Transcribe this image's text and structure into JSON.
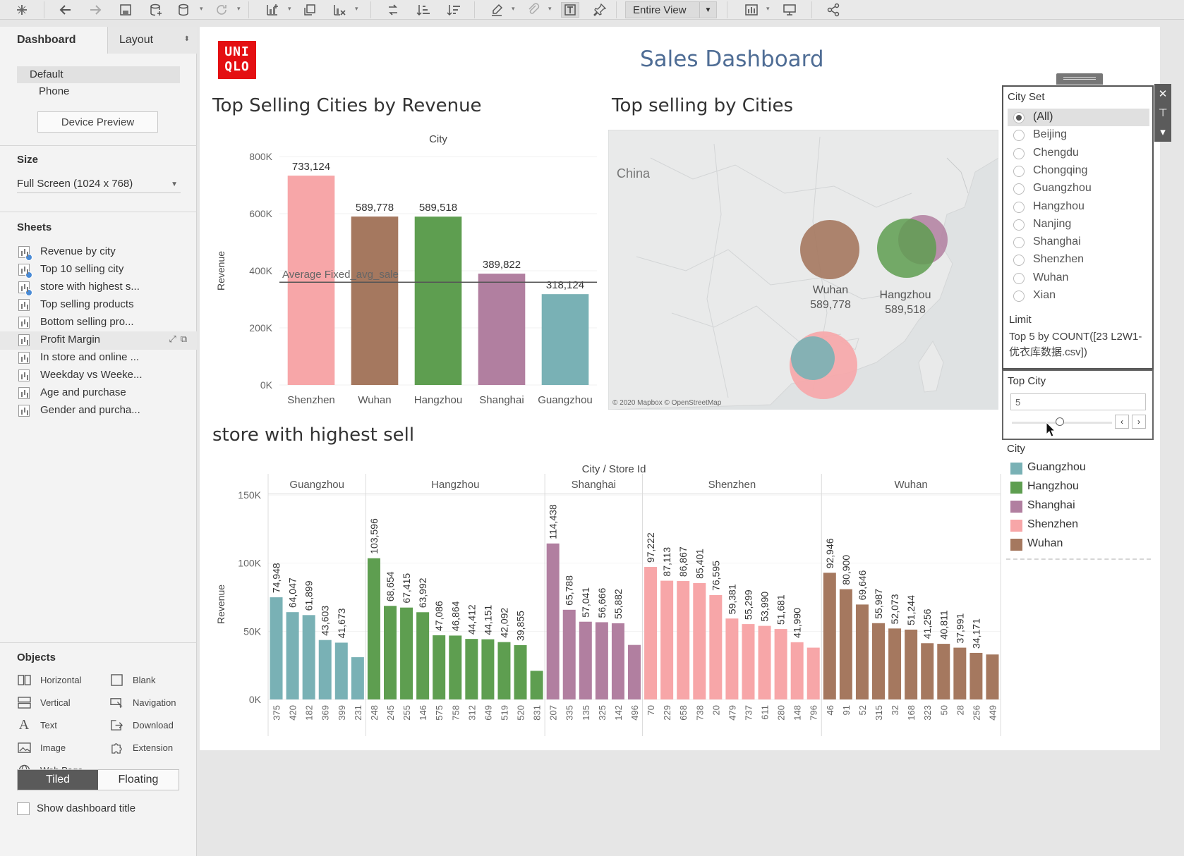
{
  "toolbar": {
    "view_select": "Entire View"
  },
  "left_panel": {
    "tabs": {
      "dashboard": "Dashboard",
      "layout": "Layout"
    },
    "devices": [
      "Default",
      "Phone"
    ],
    "device_preview": "Device Preview",
    "size_heading": "Size",
    "size_value": "Full Screen (1024 x 768)",
    "sheets_heading": "Sheets",
    "sheets": [
      "Revenue by city",
      "Top 10 selling city",
      "store with highest s...",
      "Top selling products",
      "Bottom selling pro...",
      "Profit Margin",
      "In store and online ...",
      "Weekday vs Weeke...",
      "Age and purchase",
      "Gender and purcha..."
    ],
    "objects_heading": "Objects",
    "objects": {
      "horizontal": "Horizontal",
      "blank": "Blank",
      "vertical": "Vertical",
      "navigation": "Navigation",
      "text": "Text",
      "download": "Download",
      "image": "Image",
      "extension": "Extension",
      "web_page": "Web Page"
    },
    "tiled": "Tiled",
    "floating": "Floating",
    "show_title": "Show dashboard title"
  },
  "dashboard": {
    "logo": "UNI QLO",
    "title": "Sales Dashboard"
  },
  "colors": {
    "Shenzhen": "#f7a6a8",
    "Wuhan": "#a5785f",
    "Hangzhou": "#5e9e50",
    "Shanghai": "#b17fa0",
    "Guangzhou": "#79b1b5"
  },
  "city_filter": {
    "title": "City Set",
    "options": [
      "(All)",
      "Beijing",
      "Chengdu",
      "Chongqing",
      "Guangzhou",
      "Hangzhou",
      "Nanjing",
      "Shanghai",
      "Shenzhen",
      "Wuhan",
      "Xian"
    ],
    "selected": "(All)",
    "limit_heading": "Limit",
    "limit_text": "Top 5 by COUNT([23 L2W1-优衣库数据.csv])"
  },
  "top_city_param": {
    "title": "Top City",
    "value": "5"
  },
  "legend": {
    "title": "City",
    "items": [
      "Guangzhou",
      "Hangzhou",
      "Shanghai",
      "Shenzhen",
      "Wuhan"
    ]
  },
  "map": {
    "title": "Top selling by Cities",
    "country_label": "China",
    "attribution": "© 2020 Mapbox © OpenStreetMap",
    "labels": [
      {
        "city": "Wuhan",
        "value": "589,778"
      },
      {
        "city": "Hangzhou",
        "value": "589,518"
      }
    ]
  },
  "chart_data": [
    {
      "type": "bar",
      "title": "Top Selling Cities by Revenue",
      "header": "City",
      "ylabel": "Revenue",
      "categories": [
        "Shenzhen",
        "Wuhan",
        "Hangzhou",
        "Shanghai",
        "Guangzhou"
      ],
      "values": [
        733124,
        589778,
        589518,
        389822,
        318124
      ],
      "value_labels": [
        "733,124",
        "589,778",
        "589,518",
        "389,822",
        "318,124"
      ],
      "yticks": [
        "0K",
        "200K",
        "400K",
        "600K",
        "800K"
      ],
      "ylim": [
        0,
        800000
      ],
      "reference_line": {
        "label": "Average Fixed_avg_sale",
        "value": 360000
      }
    },
    {
      "type": "bar",
      "title": "store with highest sell",
      "header": "City / Store Id",
      "ylabel": "Revenue",
      "yticks": [
        "0K",
        "50K",
        "100K",
        "150K"
      ],
      "ylim": [
        0,
        150000
      ],
      "groups": [
        {
          "city": "Guangzhou",
          "stores": [
            "375",
            "420",
            "182",
            "369",
            "399",
            "231"
          ],
          "values": [
            74948,
            64047,
            61899,
            43603,
            41673,
            31000
          ],
          "labels": [
            "74,948",
            "64,047",
            "61,899",
            "43,603",
            "41,673",
            ""
          ]
        },
        {
          "city": "Hangzhou",
          "stores": [
            "248",
            "245",
            "255",
            "146",
            "575",
            "758",
            "312",
            "649",
            "519",
            "520",
            "831"
          ],
          "values": [
            103596,
            68654,
            67415,
            63992,
            47086,
            46864,
            44412,
            44151,
            42092,
            39855,
            21000
          ],
          "labels": [
            "103,596",
            "68,654",
            "67,415",
            "63,992",
            "47,086",
            "46,864",
            "44,412",
            "44,151",
            "42,092",
            "39,855",
            ""
          ]
        },
        {
          "city": "Shanghai",
          "stores": [
            "207",
            "335",
            "135",
            "325",
            "142",
            "496"
          ],
          "values": [
            114438,
            65788,
            57041,
            56666,
            55882,
            40000
          ],
          "labels": [
            "114,438",
            "65,788",
            "57,041",
            "56,666",
            "55,882",
            ""
          ]
        },
        {
          "city": "Shenzhen",
          "stores": [
            "70",
            "229",
            "658",
            "738",
            "20",
            "479",
            "737",
            "611",
            "280",
            "148",
            "796"
          ],
          "values": [
            97222,
            87113,
            86867,
            85401,
            76595,
            59381,
            55299,
            53990,
            51681,
            41990,
            38000
          ],
          "labels": [
            "97,222",
            "87,113",
            "86,867",
            "85,401",
            "76,595",
            "59,381",
            "55,299",
            "53,990",
            "51,681",
            "41,990",
            ""
          ]
        },
        {
          "city": "Wuhan",
          "stores": [
            "46",
            "91",
            "52",
            "315",
            "32",
            "168",
            "323",
            "50",
            "28",
            "256",
            "449"
          ],
          "values": [
            92946,
            80900,
            69646,
            55987,
            52073,
            51244,
            41256,
            40811,
            37991,
            34171,
            33000
          ],
          "labels": [
            "92,946",
            "80,900",
            "69,646",
            "55,987",
            "52,073",
            "51,244",
            "41,256",
            "40,811",
            "37,991",
            "34,171",
            ""
          ]
        }
      ]
    }
  ]
}
